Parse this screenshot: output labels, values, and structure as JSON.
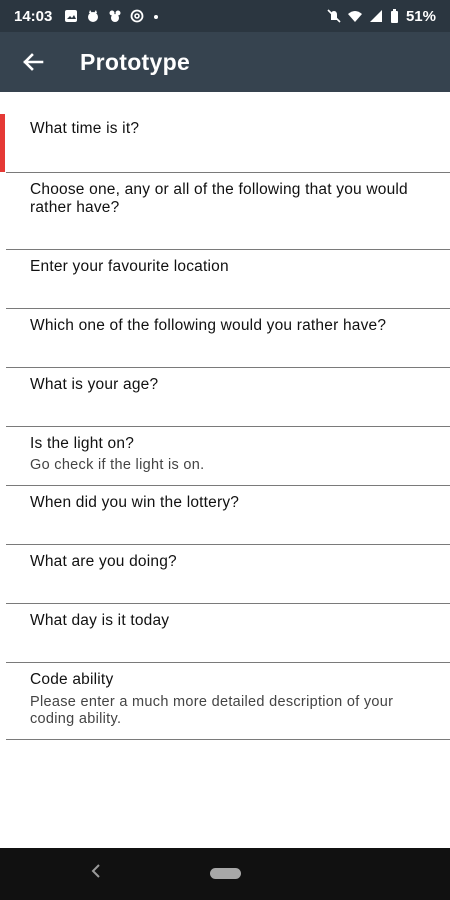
{
  "status_bar": {
    "time": "14:03",
    "left_icons": [
      "photo-icon",
      "cat-icon",
      "mouse-icon",
      "at-icon",
      "dot-icon"
    ],
    "right_icons": [
      "mute-icon",
      "wifi-icon",
      "signal-icon",
      "battery-icon"
    ],
    "battery": "51%"
  },
  "app_bar": {
    "title": "Prototype",
    "back_icon": "arrow-back-icon"
  },
  "questions": [
    {
      "label": "What time is it?",
      "description": ""
    },
    {
      "label": "Choose one, any or all of the following that you would rather have?",
      "description": ""
    },
    {
      "label": "Enter your favourite location",
      "description": ""
    },
    {
      "label": "Which one of the following would you rather have?",
      "description": ""
    },
    {
      "label": "What is your age?",
      "description": ""
    },
    {
      "label": "Is the light on?",
      "description": "Go check if the light is on."
    },
    {
      "label": "When did you win the lottery?",
      "description": ""
    },
    {
      "label": "What are you doing?",
      "description": ""
    },
    {
      "label": "What day is it today",
      "description": ""
    },
    {
      "label": "Code ability",
      "description": "Please enter a much more detailed description of your coding ability."
    }
  ],
  "active_marker_color": "#e53935",
  "nav_bar": {
    "back_icon": "triangle-back-icon",
    "home_icon": "home-pill-icon"
  }
}
